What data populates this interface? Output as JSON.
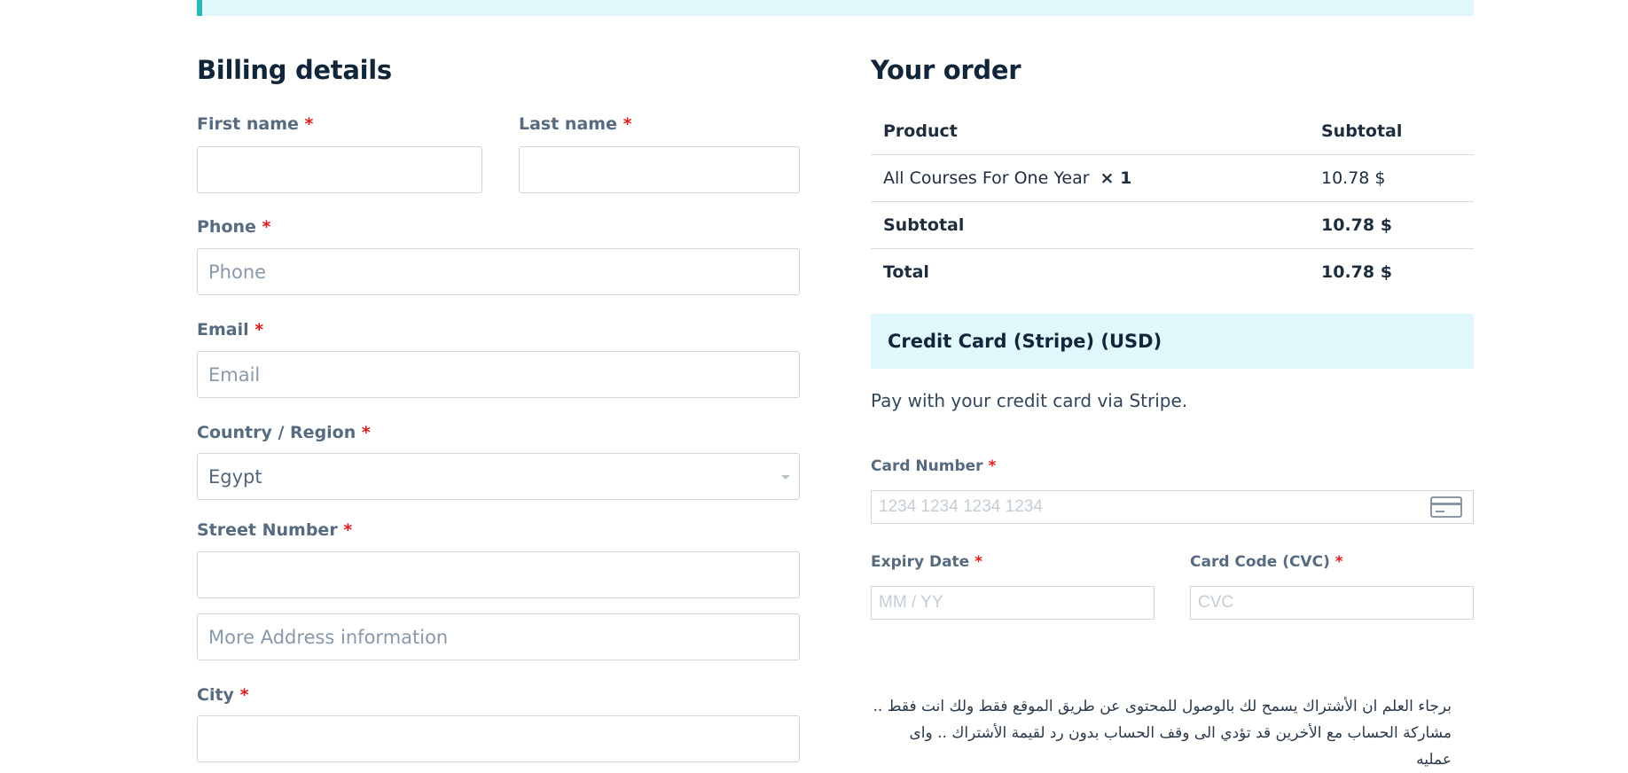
{
  "billing": {
    "title": "Billing details",
    "required_mark": "*",
    "first_name": {
      "label": "First name",
      "value": ""
    },
    "last_name": {
      "label": "Last name",
      "value": ""
    },
    "phone": {
      "label": "Phone",
      "placeholder": "Phone"
    },
    "email": {
      "label": "Email",
      "placeholder": "Email"
    },
    "country": {
      "label": "Country / Region",
      "value": "Egypt"
    },
    "street": {
      "label": "Street Number",
      "value": "",
      "placeholder_2": "More Address information"
    },
    "city": {
      "label": "City",
      "value": ""
    }
  },
  "order": {
    "title": "Your order",
    "headers": {
      "product": "Product",
      "subtotal": "Subtotal"
    },
    "item": {
      "name": "All Courses For One Year",
      "qty": "× 1",
      "price": "10.78 $"
    },
    "subtotal": {
      "label": "Subtotal",
      "value": "10.78 $"
    },
    "total": {
      "label": "Total",
      "value": "10.78 $"
    }
  },
  "payment": {
    "method": "Credit Card (Stripe) (USD)",
    "description": "Pay with your credit card via Stripe.",
    "card_number": {
      "label": "Card Number",
      "placeholder": "1234 1234 1234 1234",
      "icon": "credit-card-icon"
    },
    "expiry": {
      "label": "Expiry Date",
      "placeholder": "MM / YY"
    },
    "cvc": {
      "label": "Card Code (CVC)",
      "placeholder": "CVC"
    },
    "notice_line1": "برجاء العلم ان الأشتراك يسمح لك بالوصول للمحتوى عن طريق الموقع فقط ولك انت فقط ..",
    "notice_line2": "مشاركة الحساب مع الأخرين قد تؤدي الى وقف الحساب بدون رد لقيمة الأشتراك .. واى عمليه"
  },
  "colors": {
    "accent": "#2ab7b9",
    "notice_bg": "#e0f8fb",
    "required": "#e01b1b",
    "heading": "#12263a"
  }
}
